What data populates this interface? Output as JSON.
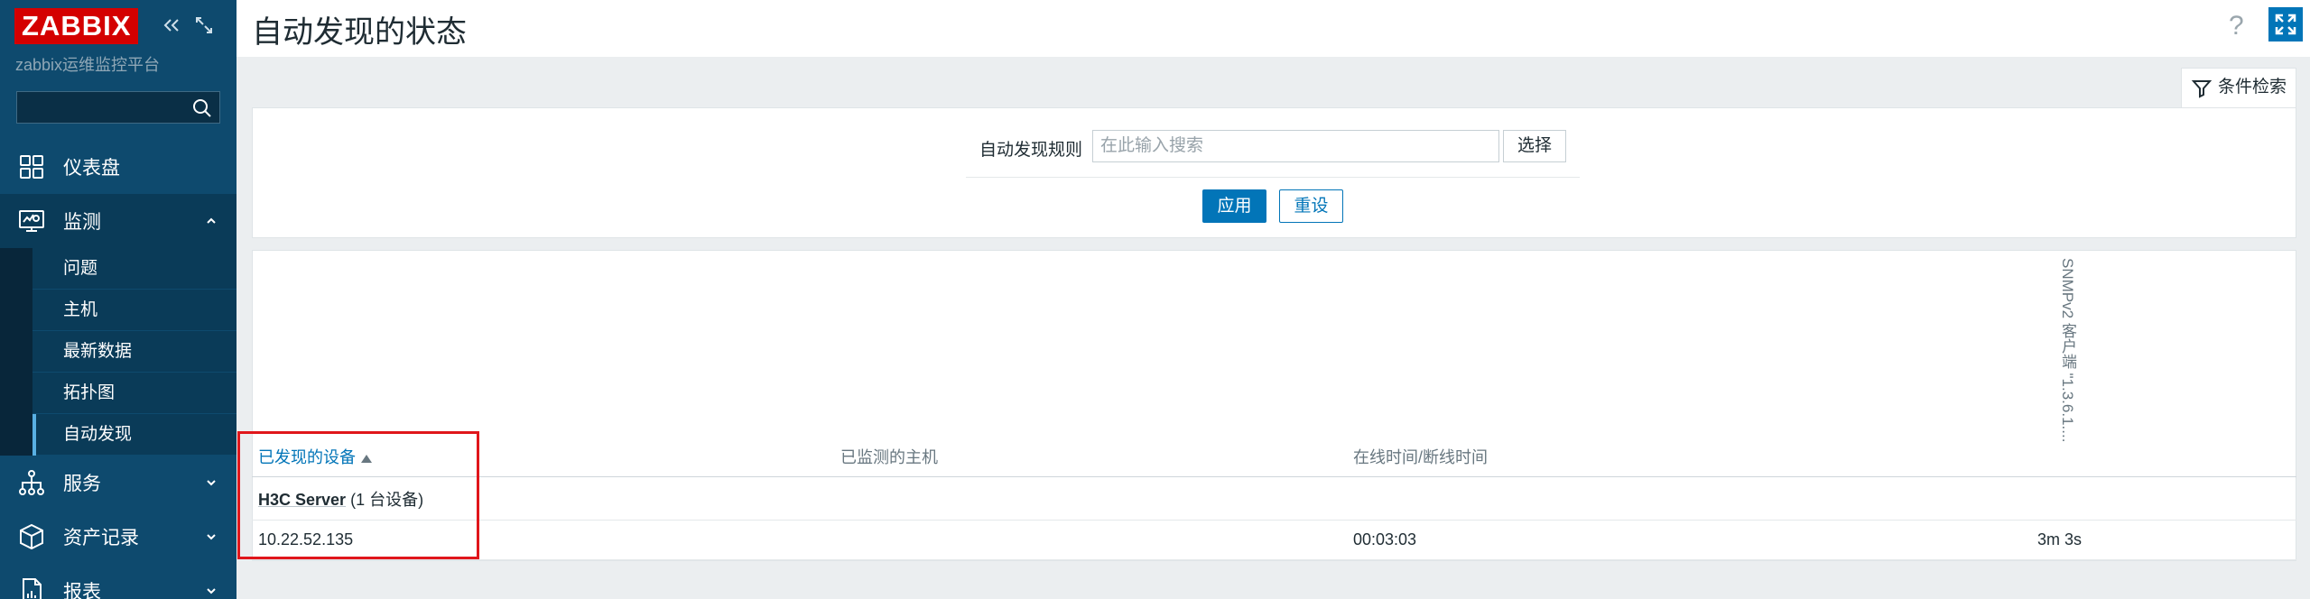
{
  "sidebar": {
    "logo": "ZABBIX",
    "subtitle": "zabbix运维监控平台",
    "search_placeholder": "",
    "items": [
      {
        "label": "仪表盘",
        "icon": "dashboard-icon"
      },
      {
        "label": "监测",
        "icon": "monitoring-icon",
        "expanded": true
      },
      {
        "label": "服务",
        "icon": "services-icon"
      },
      {
        "label": "资产记录",
        "icon": "inventory-icon"
      },
      {
        "label": "报表",
        "icon": "reports-icon"
      }
    ],
    "submenu": [
      "问题",
      "主机",
      "最新数据",
      "拓扑图",
      "自动发现"
    ],
    "selected_submenu": "自动发现"
  },
  "header": {
    "title": "自动发现的状态",
    "help": "?"
  },
  "filter": {
    "tab_label": "条件检索",
    "rule_label": "自动发现规则",
    "rule_placeholder": "在此输入搜索",
    "select_label": "选择",
    "apply_label": "应用",
    "reset_label": "重设"
  },
  "table": {
    "columns": [
      "已发现的设备",
      "已监测的主机",
      "在线时间/断线时间"
    ],
    "vertical_column": "SNMPv2 客户端 \"1.3.6.1....",
    "group": {
      "name": "H3C Server",
      "count": "(1 台设备)"
    },
    "rows": [
      {
        "device": "10.22.52.135",
        "host": "",
        "uptime": "00:03:03",
        "snmp": "3m 3s"
      }
    ]
  },
  "colors": {
    "sidebar_bg": "#0e4a6e",
    "accent": "#0275b8",
    "logo_bg": "#d40000",
    "highlight": "#e0161b"
  }
}
